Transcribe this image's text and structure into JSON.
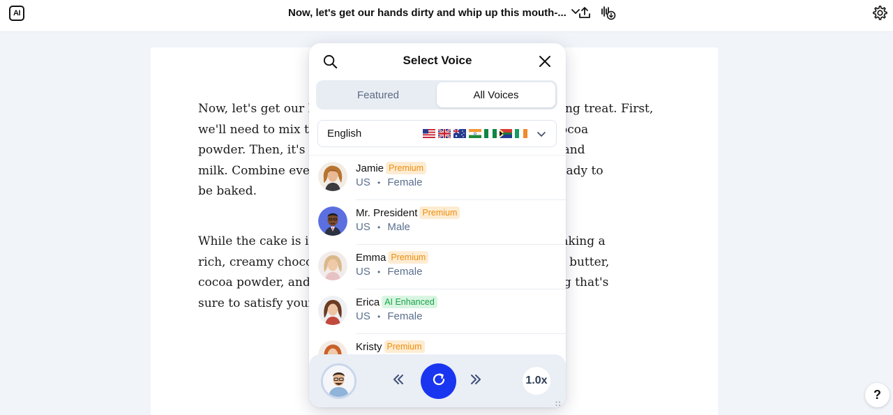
{
  "app": {
    "logo_text": "AI",
    "doc_title": "Now, let's get our hands dirty and whip up this mouth-..."
  },
  "icons": {
    "logo": "ai-logo-icon",
    "title_chevron": "chevron-down-icon",
    "upload": "upload-icon",
    "audio_download": "audio-download-icon",
    "settings": "gear-icon",
    "search": "search-icon",
    "close": "close-icon",
    "rewind": "rewind-icon",
    "play": "refresh-play-icon",
    "forward": "forward-icon",
    "help": "help-icon"
  },
  "document": {
    "paragraphs": [
      {
        "lines": [
          "Now, let's get our hands dirty and whip up this mouth-watering treat. First,",
          "we'll need to mix the flour, baking powder, salt, sugar, and cocoa",
          "powder. Then, it's time to add the milk, melted butter, eggs, and",
          "milk. Combine everything until you've got a smooth batter ready to",
          "be baked."
        ]
      },
      {
        "lines": [
          "While the cake is in the oven, we're not done yet. We'll be making a",
          "rich, creamy chocolate frosting. We'll need to whisk together butter,",
          "cocoa powder, and powdered sugar to get a decadent frosting that's",
          "sure to satisfy your sweet tooth."
        ]
      }
    ]
  },
  "voice_panel": {
    "title": "Select Voice",
    "tabs": [
      {
        "label": "Featured",
        "active": false
      },
      {
        "label": "All Voices",
        "active": true
      }
    ],
    "language": {
      "selected": "English",
      "flags": [
        "US",
        "UK",
        "AU",
        "IN",
        "NG",
        "ZA",
        "IE"
      ]
    },
    "voices": [
      {
        "name": "Jamie",
        "badge": "Premium",
        "badge_type": "premium",
        "region": "US",
        "gender": "Female"
      },
      {
        "name": "Mr. President",
        "badge": "Premium",
        "badge_type": "premium",
        "region": "US",
        "gender": "Male"
      },
      {
        "name": "Emma",
        "badge": "Premium",
        "badge_type": "premium",
        "region": "US",
        "gender": "Female"
      },
      {
        "name": "Erica",
        "badge": "AI Enhanced",
        "badge_type": "enhanced",
        "region": "US",
        "gender": "Female"
      },
      {
        "name": "Kristy",
        "badge": "Premium",
        "badge_type": "premium",
        "region": "",
        "gender": ""
      }
    ],
    "meta_separator": "•"
  },
  "player": {
    "speed": "1.0x"
  },
  "help_label": "?",
  "colors": {
    "accent": "#1a35f0",
    "premium_bg": "#fdecd2",
    "premium_text": "#ef8e0e",
    "enhanced_bg": "#d9f5e1",
    "enhanced_text": "#19a44a"
  }
}
